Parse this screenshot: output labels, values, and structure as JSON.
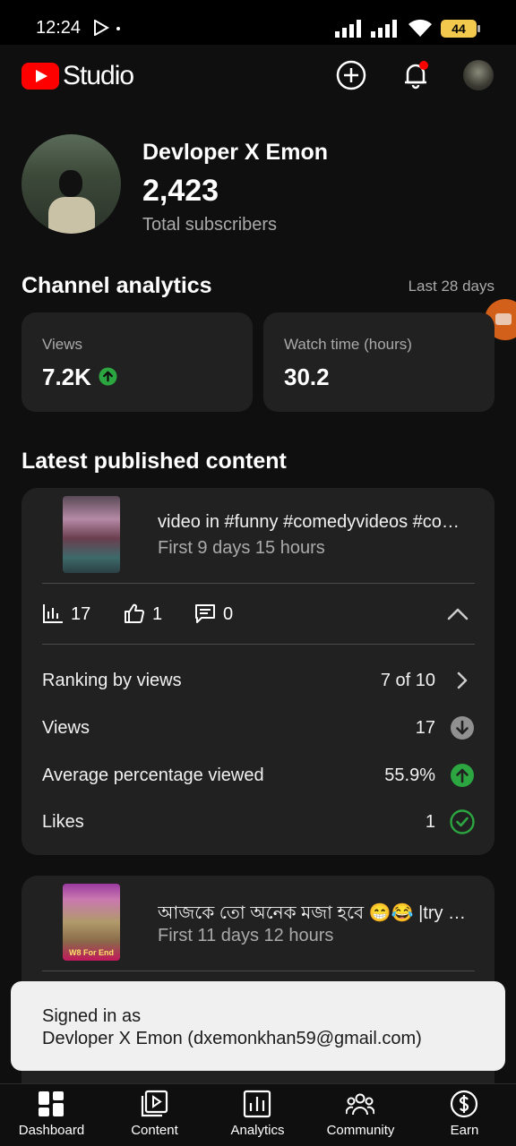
{
  "status_bar": {
    "time": "12:24",
    "battery": "44"
  },
  "header": {
    "logo_text": "Studio"
  },
  "channel": {
    "name": "Devloper X Emon",
    "subscriber_count": "2,423",
    "subscriber_label": "Total subscribers"
  },
  "analytics": {
    "title": "Channel analytics",
    "range": "Last 28 days",
    "views_label": "Views",
    "views_value": "7.2K",
    "watch_label": "Watch time (hours)",
    "watch_value": "30.2"
  },
  "latest": {
    "title": "Latest published content",
    "items": [
      {
        "title": "video in #funny #comedyvideos #co…",
        "age": "First 9 days 15 hours",
        "views": "17",
        "likes": "1",
        "comments": "0",
        "details": [
          {
            "label": "Ranking by views",
            "value": "7 of 10",
            "icon": "chevron-right-icon"
          },
          {
            "label": "Views",
            "value": "17",
            "icon": "arrow-down-circle-icon"
          },
          {
            "label": "Average percentage viewed",
            "value": "55.9%",
            "icon": "arrow-up-circle-icon"
          },
          {
            "label": "Likes",
            "value": "1",
            "icon": "check-circle-icon"
          }
        ]
      },
      {
        "title": "আজকে তো অনেক মজা হবে 😁😂 |try …",
        "age": "First 11 days 12 hours",
        "thumb_caption": "W8 For End"
      }
    ]
  },
  "toast": {
    "line1": "Signed in as",
    "line2": "Devloper X Emon (dxemonkhan59@gmail.com)"
  },
  "nav": {
    "items": [
      {
        "label": "Dashboard",
        "icon": "dashboard-icon"
      },
      {
        "label": "Content",
        "icon": "content-icon"
      },
      {
        "label": "Analytics",
        "icon": "analytics-icon"
      },
      {
        "label": "Community",
        "icon": "community-icon"
      },
      {
        "label": "Earn",
        "icon": "earn-icon"
      }
    ]
  },
  "colors": {
    "accent_red": "#ff0000",
    "up_green": "#2ba640",
    "background": "#0f0f0f",
    "card": "#212121"
  }
}
